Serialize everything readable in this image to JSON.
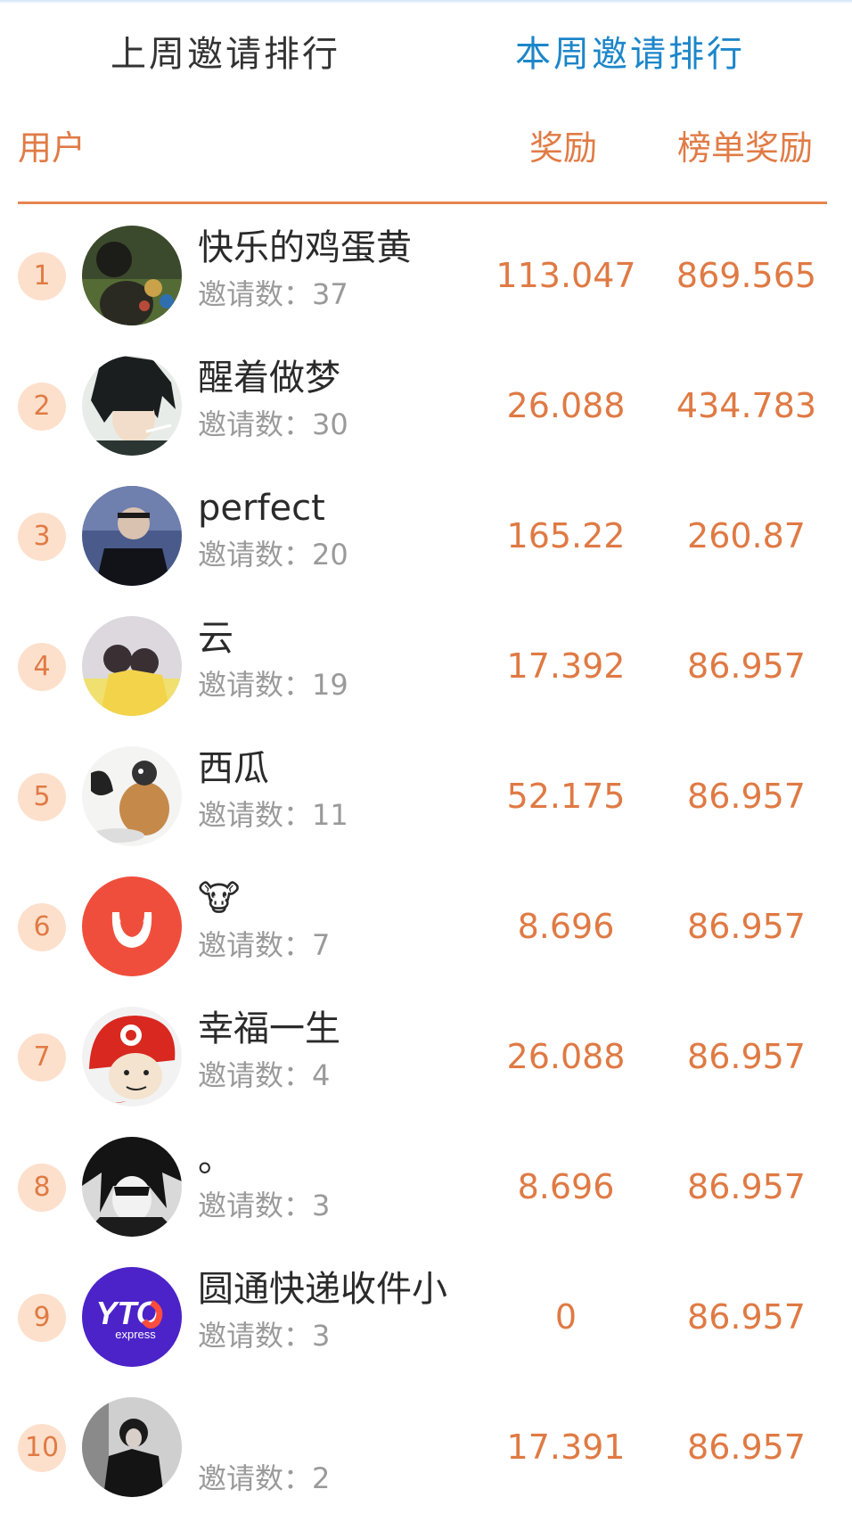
{
  "tabs": {
    "last_week": "上周邀请排行",
    "this_week": "本周邀请排行"
  },
  "header": {
    "user": "用户",
    "reward": "奖励",
    "list_reward": "榜单奖励"
  },
  "colors": {
    "accent": "#e07b45",
    "active_tab": "#1c86c9",
    "rank_badge": "#fde0cc"
  },
  "rows": [
    {
      "rank": "1",
      "name": "快乐的鸡蛋黄",
      "invites": "邀请数：37",
      "reward": "113.047",
      "list_reward": "869.565",
      "avatar_icon": "photo-avatar-icon"
    },
    {
      "rank": "2",
      "name": "醒着做梦",
      "invites": "邀请数：30",
      "reward": "26.088",
      "list_reward": "434.783",
      "avatar_icon": "anime-avatar-icon"
    },
    {
      "rank": "3",
      "name": "perfect",
      "invites": "邀请数：20",
      "reward": "165.22",
      "list_reward": "260.87",
      "avatar_icon": "photo-avatar-icon"
    },
    {
      "rank": "4",
      "name": "云",
      "invites": "邀请数：19",
      "reward": "17.392",
      "list_reward": "86.957",
      "avatar_icon": "photo-avatar-icon"
    },
    {
      "rank": "5",
      "name": "西瓜",
      "invites": "邀请数：11",
      "reward": "52.175",
      "list_reward": "86.957",
      "avatar_icon": "cartoon-avatar-icon"
    },
    {
      "rank": "6",
      "name": "🐮",
      "invites": "邀请数：7",
      "reward": "8.696",
      "list_reward": "86.957",
      "avatar_icon": "red-logo-avatar-icon"
    },
    {
      "rank": "7",
      "name": "幸福一生",
      "invites": "邀请数：4",
      "reward": "26.088",
      "list_reward": "86.957",
      "avatar_icon": "meme-avatar-icon"
    },
    {
      "rank": "8",
      "name": "。",
      "invites": "邀请数：3",
      "reward": "8.696",
      "list_reward": "86.957",
      "avatar_icon": "anime-avatar-icon"
    },
    {
      "rank": "9",
      "name": "圆通快递收件小",
      "invites": "邀请数：3",
      "reward": "0",
      "list_reward": "86.957",
      "avatar_icon": "yto-express-logo-icon",
      "logo_text": "YTO",
      "logo_subtext": "express"
    },
    {
      "rank": "10",
      "name": "",
      "invites": "邀请数：2",
      "reward": "17.391",
      "list_reward": "86.957",
      "avatar_icon": "photo-avatar-icon"
    }
  ]
}
